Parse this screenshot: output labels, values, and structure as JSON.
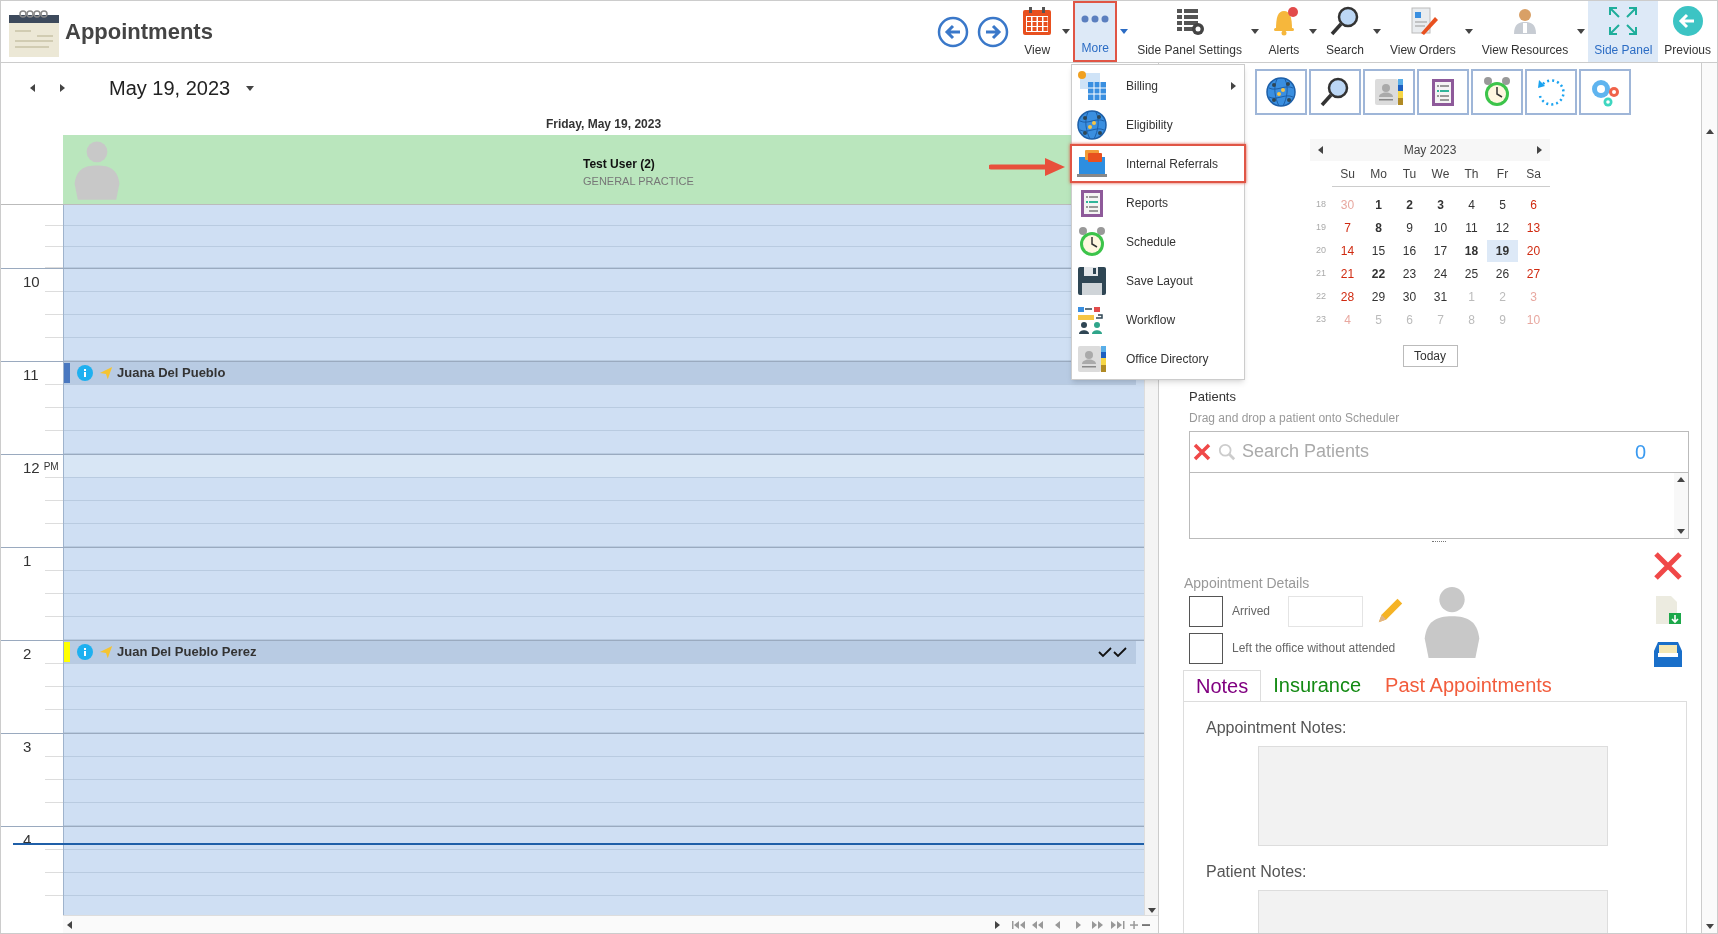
{
  "header": {
    "title": "Appointments"
  },
  "toolbar": [
    {
      "label": "View",
      "dropdown": true,
      "selected": false,
      "open": false
    },
    {
      "label": "More",
      "dropdown": true,
      "selected": true,
      "open": true
    },
    {
      "label": "Side Panel Settings",
      "dropdown": true,
      "selected": false,
      "open": false
    },
    {
      "label": "Alerts",
      "dropdown": true,
      "selected": false,
      "open": false
    },
    {
      "label": "Search",
      "dropdown": true,
      "selected": false,
      "open": false
    },
    {
      "label": "View Orders",
      "dropdown": true,
      "selected": false,
      "open": false
    },
    {
      "label": "View Resources",
      "dropdown": true,
      "selected": false,
      "open": false
    },
    {
      "label": "Side Panel",
      "dropdown": false,
      "selected": true,
      "open": false
    },
    {
      "label": "Previous",
      "dropdown": false,
      "selected": false,
      "open": false
    }
  ],
  "more_menu": [
    {
      "label": "Billing",
      "submenu": true,
      "highlighted": false
    },
    {
      "label": "Eligibility",
      "submenu": false,
      "highlighted": false
    },
    {
      "label": "Internal Referrals",
      "submenu": false,
      "highlighted": true
    },
    {
      "label": "Reports",
      "submenu": false,
      "highlighted": false
    },
    {
      "label": "Schedule",
      "submenu": false,
      "highlighted": false
    },
    {
      "label": "Save Layout",
      "submenu": false,
      "highlighted": false
    },
    {
      "label": "Workflow",
      "submenu": false,
      "highlighted": false
    },
    {
      "label": "Office Directory",
      "submenu": false,
      "highlighted": false
    }
  ],
  "scheduler": {
    "date": "May 19, 2023",
    "day_header": "Friday, May 19, 2023",
    "resource": {
      "name": "Test User (2)",
      "specialty": "GENERAL PRACTICE"
    },
    "hours": [
      {
        "label": "10"
      },
      {
        "label": "11",
        "appointments": [
          {
            "name": "Juana Del Pueblo",
            "color": "#4a78c0",
            "confirmed": false
          }
        ]
      },
      {
        "label": "12",
        "suffix": "PM"
      },
      {
        "label": "1"
      },
      {
        "label": "2",
        "appointments": [
          {
            "name": "Juan Del Pueblo Perez",
            "color": "#ffff00",
            "confirmed": true
          }
        ]
      },
      {
        "label": "3"
      },
      {
        "label": "4"
      }
    ]
  },
  "mini_calendar": {
    "month": "May 2023",
    "weekdays": [
      "Su",
      "Mo",
      "Tu",
      "We",
      "Th",
      "Fr",
      "Sa"
    ],
    "weeks": [
      {
        "number": "18",
        "days": [
          {
            "label": "30",
            "muted": true,
            "bold": false,
            "selected": false
          },
          {
            "label": "1",
            "muted": false,
            "bold": true,
            "selected": false
          },
          {
            "label": "2",
            "muted": false,
            "bold": true,
            "selected": false
          },
          {
            "label": "3",
            "muted": false,
            "bold": true,
            "selected": false
          },
          {
            "label": "4",
            "muted": false,
            "bold": false,
            "selected": false
          },
          {
            "label": "5",
            "muted": false,
            "bold": false,
            "selected": false
          },
          {
            "label": "6",
            "muted": false,
            "bold": false,
            "selected": false
          }
        ]
      },
      {
        "number": "19",
        "days": [
          {
            "label": "7",
            "muted": false,
            "bold": false,
            "selected": false
          },
          {
            "label": "8",
            "muted": false,
            "bold": true,
            "selected": false
          },
          {
            "label": "9",
            "muted": false,
            "bold": false,
            "selected": false
          },
          {
            "label": "10",
            "muted": false,
            "bold": false,
            "selected": false
          },
          {
            "label": "11",
            "muted": false,
            "bold": false,
            "selected": false
          },
          {
            "label": "12",
            "muted": false,
            "bold": false,
            "selected": false
          },
          {
            "label": "13",
            "muted": false,
            "bold": false,
            "selected": false
          }
        ]
      },
      {
        "number": "20",
        "days": [
          {
            "label": "14",
            "muted": false,
            "bold": false,
            "selected": false
          },
          {
            "label": "15",
            "muted": false,
            "bold": false,
            "selected": false
          },
          {
            "label": "16",
            "muted": false,
            "bold": false,
            "selected": false
          },
          {
            "label": "17",
            "muted": false,
            "bold": false,
            "selected": false
          },
          {
            "label": "18",
            "muted": false,
            "bold": true,
            "selected": false
          },
          {
            "label": "19",
            "muted": false,
            "bold": true,
            "selected": true
          },
          {
            "label": "20",
            "muted": false,
            "bold": false,
            "selected": false
          }
        ]
      },
      {
        "number": "21",
        "days": [
          {
            "label": "21",
            "muted": false,
            "bold": false,
            "selected": false
          },
          {
            "label": "22",
            "muted": false,
            "bold": true,
            "selected": false
          },
          {
            "label": "23",
            "muted": false,
            "bold": false,
            "selected": false
          },
          {
            "label": "24",
            "muted": false,
            "bold": false,
            "selected": false
          },
          {
            "label": "25",
            "muted": false,
            "bold": false,
            "selected": false
          },
          {
            "label": "26",
            "muted": false,
            "bold": false,
            "selected": false
          },
          {
            "label": "27",
            "muted": false,
            "bold": false,
            "selected": false
          }
        ]
      },
      {
        "number": "22",
        "days": [
          {
            "label": "28",
            "muted": false,
            "bold": false,
            "selected": false
          },
          {
            "label": "29",
            "muted": false,
            "bold": false,
            "selected": false
          },
          {
            "label": "30",
            "muted": false,
            "bold": false,
            "selected": false
          },
          {
            "label": "31",
            "muted": false,
            "bold": false,
            "selected": false
          },
          {
            "label": "1",
            "muted": true,
            "bold": false,
            "selected": false
          },
          {
            "label": "2",
            "muted": true,
            "bold": false,
            "selected": false
          },
          {
            "label": "3",
            "muted": true,
            "bold": false,
            "selected": false
          }
        ]
      },
      {
        "number": "23",
        "days": [
          {
            "label": "4",
            "muted": true,
            "bold": false,
            "selected": false
          },
          {
            "label": "5",
            "muted": true,
            "bold": false,
            "selected": false
          },
          {
            "label": "6",
            "muted": true,
            "bold": false,
            "selected": false
          },
          {
            "label": "7",
            "muted": true,
            "bold": false,
            "selected": false
          },
          {
            "label": "8",
            "muted": true,
            "bold": false,
            "selected": false
          },
          {
            "label": "9",
            "muted": true,
            "bold": false,
            "selected": false
          },
          {
            "label": "10",
            "muted": true,
            "bold": false,
            "selected": false
          }
        ]
      }
    ],
    "today_button": "Today"
  },
  "patients": {
    "title": "Patients",
    "hint": "Drag and drop a patient onto Scheduler",
    "search_placeholder": "Search Patients",
    "count": "0"
  },
  "appointment_details": {
    "title": "Appointment Details",
    "checkboxes": [
      {
        "label": "Arrived",
        "checked": false
      },
      {
        "label": "Left the office without attended",
        "checked": false
      }
    ],
    "tabs": [
      {
        "label": "Notes",
        "selected": true,
        "color": "#800080"
      },
      {
        "label": "Insurance",
        "selected": false,
        "color": "#138a13"
      },
      {
        "label": "Past Appointments",
        "selected": false,
        "color": "#f25c3c"
      }
    ],
    "notes": [
      {
        "label": "Appointment Notes:"
      },
      {
        "label": "Patient Notes:"
      }
    ]
  }
}
